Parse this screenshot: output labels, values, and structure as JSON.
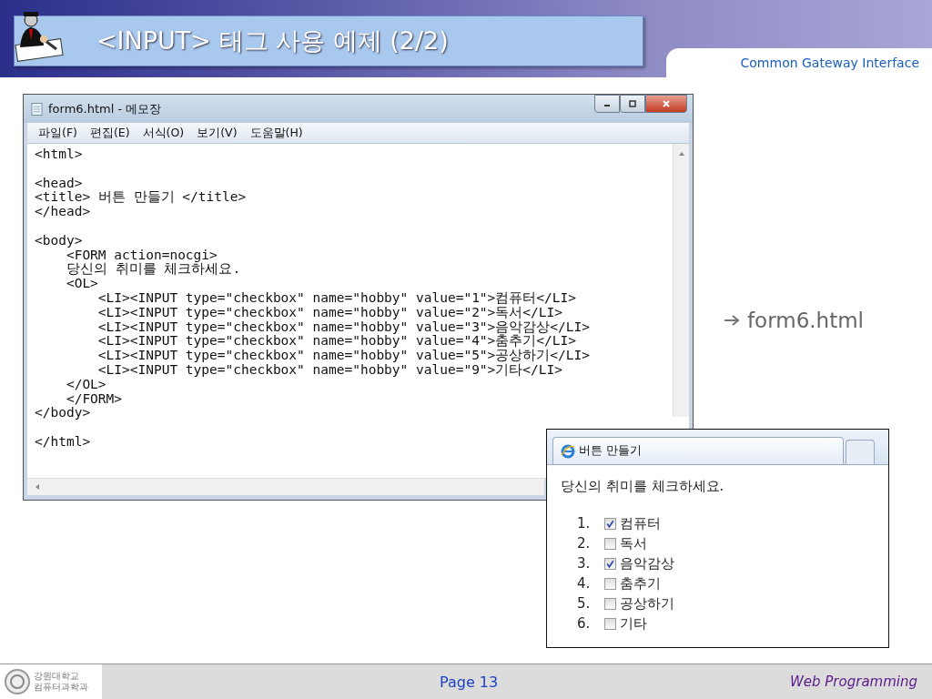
{
  "header": {
    "title": "<INPUT> 태그 사용 예제 (2/2)",
    "subtitle": "Common Gateway Interface"
  },
  "notepad": {
    "title": "form6.html - 메모장",
    "menu": [
      "파일(F)",
      "편집(E)",
      "서식(O)",
      "보기(V)",
      "도움말(H)"
    ],
    "blocks": [
      [
        "<html>"
      ],
      [
        "<head>",
        "<title> 버튼 만들기 </title>",
        "</head>"
      ],
      [
        "<body>",
        "    <FORM action=nocgi>",
        "    당신의 취미를 체크하세요.",
        "    <OL>",
        "        <LI><INPUT type=\"checkbox\" name=\"hobby\" value=\"1\">컴퓨터</LI>",
        "        <LI><INPUT type=\"checkbox\" name=\"hobby\" value=\"2\">독서</LI>",
        "        <LI><INPUT type=\"checkbox\" name=\"hobby\" value=\"3\">음악감상</LI>",
        "        <LI><INPUT type=\"checkbox\" name=\"hobby\" value=\"4\">춤추기</LI>",
        "        <LI><INPUT type=\"checkbox\" name=\"hobby\" value=\"5\">공상하기</LI>",
        "        <LI><INPUT type=\"checkbox\" name=\"hobby\" value=\"9\">기타</LI>",
        "    </OL>",
        "    </FORM>",
        "</body>"
      ],
      [
        "</html>"
      ]
    ]
  },
  "caption": "form6.html",
  "browser": {
    "tab_title": "버튼 만들기",
    "prompt": "당신의 취미를 체크하세요.",
    "items": [
      {
        "number": "1.",
        "label": "컴퓨터",
        "checked": true
      },
      {
        "number": "2.",
        "label": "독서",
        "checked": false
      },
      {
        "number": "3.",
        "label": "음악감상",
        "checked": true
      },
      {
        "number": "4.",
        "label": "춤추기",
        "checked": false
      },
      {
        "number": "5.",
        "label": "공상하기",
        "checked": false
      },
      {
        "number": "6.",
        "label": "기타",
        "checked": false
      }
    ]
  },
  "footer": {
    "logo_lines": [
      "강원대학교",
      "컴퓨터과학과"
    ],
    "page": "Page 13",
    "course": "Web Programming"
  }
}
